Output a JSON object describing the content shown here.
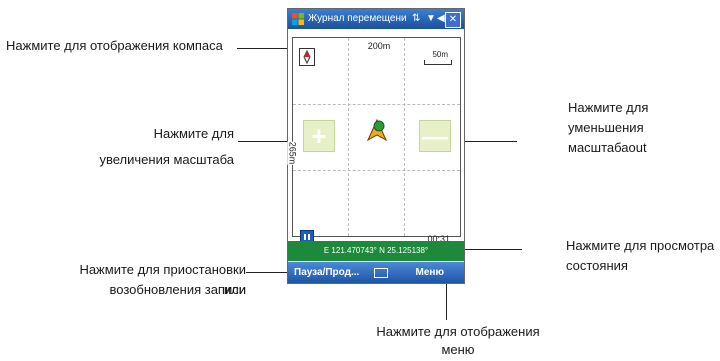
{
  "device": {
    "title": "Журнал перемещени",
    "scale_top": "200m",
    "scale_side": "265m",
    "ruler_label": "50m",
    "timer": "00:31",
    "coordinates": "E 121.470743° N 25.125138°",
    "menu": {
      "left": "Пауза/Прод...",
      "right": "Меню"
    },
    "zoom_in": "+",
    "zoom_out": "—"
  },
  "callouts": {
    "compass": "Нажмите для отображения компаса",
    "zoom_in_1": "Нажмите для",
    "zoom_in_2": "увеличения масштаба",
    "zoom_out_1": "Нажмите для",
    "zoom_out_2": "уменьшения",
    "zoom_out_3": "масштабаout",
    "status_1": "Нажмите для просмотра",
    "status_2": "состояния",
    "pause_1": "Нажмите для приостановки или",
    "pause_2": "возобновления записи",
    "menu_1": "Нажмите для отображения",
    "menu_2": "меню"
  },
  "colors": {
    "titlebar": "#1c4f9c",
    "coordbar": "#1c8a3a",
    "menubar": "#1d55a6",
    "zoom_bg": "#e8f0c8"
  }
}
